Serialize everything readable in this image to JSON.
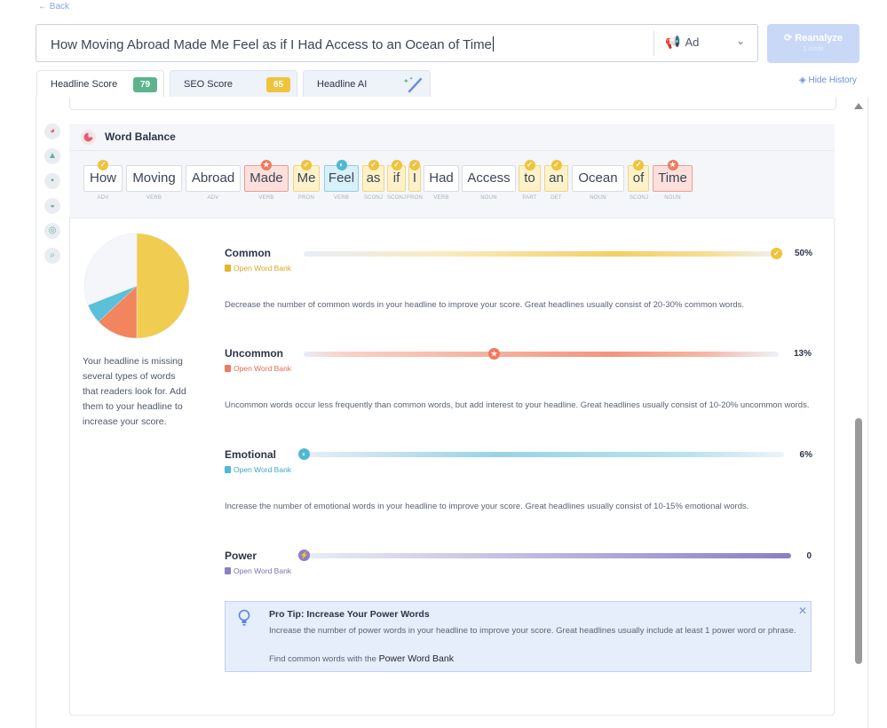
{
  "nav": {
    "back_label": "← Back"
  },
  "headline": {
    "value": "How Moving Abroad Made Me Feel as if I Had Access to an Ocean of Time"
  },
  "type_select": {
    "value": "Ad",
    "icon": "megaphone-icon"
  },
  "reanalyze": {
    "label": "⟳ Reanalyze",
    "sub": "1 credit"
  },
  "tabs": [
    {
      "label": "Headline Score",
      "score": "79",
      "color": "#5cb48c",
      "active": true
    },
    {
      "label": "SEO Score",
      "score": "65",
      "color": "#f0c33c"
    },
    {
      "label": "Headline AI",
      "icon": "magic-wand-icon"
    }
  ],
  "hide_history": "Hide History",
  "section": {
    "title": "Word Balance"
  },
  "words": [
    {
      "text": "How",
      "pos": "ADV",
      "type": "common"
    },
    {
      "text": "Moving",
      "pos": "VERB",
      "type": "none"
    },
    {
      "text": "Abroad",
      "pos": "ADV",
      "type": "none"
    },
    {
      "text": "Made",
      "pos": "VERB",
      "type": "uncommon"
    },
    {
      "text": "Me",
      "pos": "PRON",
      "type": "common"
    },
    {
      "text": "Feel",
      "pos": "VERB",
      "type": "emotional"
    },
    {
      "text": "as",
      "pos": "SCONJ",
      "type": "common"
    },
    {
      "text": "if",
      "pos": "SCONJ",
      "type": "common"
    },
    {
      "text": "I",
      "pos": "PRON",
      "type": "common"
    },
    {
      "text": "Had",
      "pos": "VERB",
      "type": "none"
    },
    {
      "text": "Access",
      "pos": "NOUN",
      "type": "none"
    },
    {
      "text": "to",
      "pos": "PART",
      "type": "common"
    },
    {
      "text": "an",
      "pos": "DET",
      "type": "common"
    },
    {
      "text": "Ocean",
      "pos": "NOUN",
      "type": "none"
    },
    {
      "text": "of",
      "pos": "SCONJ",
      "type": "common"
    },
    {
      "text": "Time",
      "pos": "NOUN",
      "type": "uncommon"
    }
  ],
  "chart_data": {
    "type": "pie",
    "slices": [
      {
        "name": "Common",
        "value": 50,
        "color": "#f0cd50"
      },
      {
        "name": "Uncommon",
        "value": 13,
        "color": "#f2845e"
      },
      {
        "name": "Emotional",
        "value": 6,
        "color": "#5bc0d9"
      },
      {
        "name": "Power",
        "value": 0,
        "color": "#8b7fc4"
      },
      {
        "name": "Other",
        "value": 31,
        "color": "#f4f6fa"
      }
    ]
  },
  "missing_note": "Your headline is missing several types of words that readers look for. Add them to your headline to increase your score.",
  "metrics": [
    {
      "label": "Common",
      "bank": "Open Word Bank",
      "pct": "50%",
      "value": 0.5,
      "color": "#f0c33c",
      "desc": "Decrease the number of common words in your headline to improve your score. Great headlines usually consist of 20-30% common words."
    },
    {
      "label": "Uncommon",
      "bank": "Open Word Bank",
      "pct": "13%",
      "value": 0.13,
      "color": "#f07a5c",
      "desc": "Uncommon words occur less frequently than common words, but add interest to your headline. Great headlines usually consist of 10-20% uncommon words."
    },
    {
      "label": "Emotional",
      "bank": "Open Word Bank",
      "pct": "6%",
      "value": 0.06,
      "color": "#4fb8d4",
      "desc": "Increase the number of emotional words in your headline to improve your score. Great headlines usually consist of 10-15% emotional words."
    },
    {
      "label": "Power",
      "bank": "Open Word Bank",
      "pct": "0",
      "value": 0,
      "color": "#8b7fc4",
      "desc": ""
    }
  ],
  "tip": {
    "title": "Pro Tip: Increase Your Power Words",
    "text": "Increase the number of power words in your headline to improve your score. Great headlines usually include at least 1 power word or phrase.",
    "find_prefix": "Find common words with the",
    "link": "Power Word Bank",
    "close": "✕"
  }
}
